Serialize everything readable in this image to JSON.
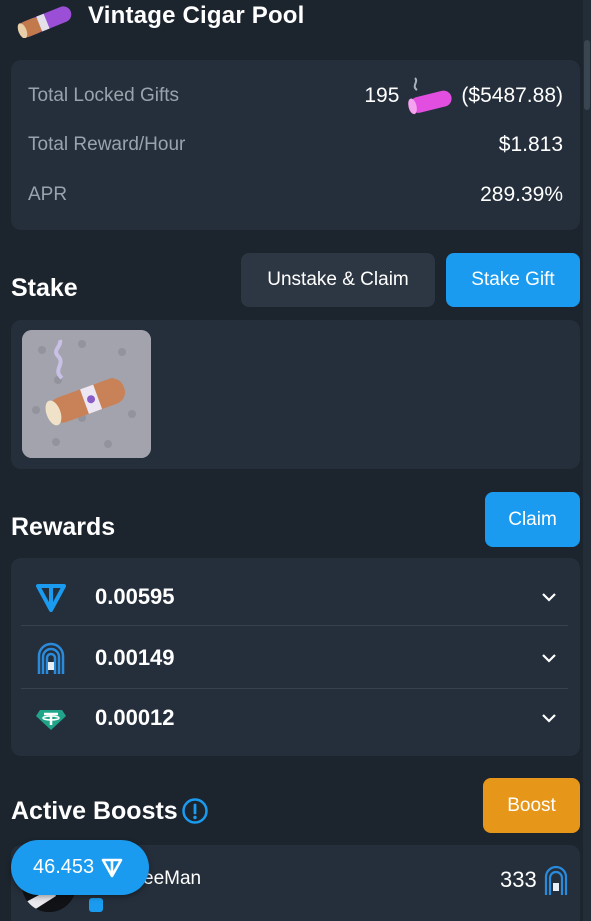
{
  "header": {
    "title": "Vintage Cigar Pool",
    "icon": "cigar-icon"
  },
  "stats": {
    "locked_label": "Total Locked Gifts",
    "locked_count": "195",
    "locked_usd": "($5487.88)",
    "reward_label": "Total Reward/Hour",
    "reward_value": "$1.813",
    "apr_label": "APR",
    "apr_value": "289.39%"
  },
  "stake": {
    "title": "Stake",
    "unstake_label": "Unstake & Claim",
    "stake_gift_label": "Stake Gift"
  },
  "rewards": {
    "title": "Rewards",
    "claim_label": "Claim",
    "items": [
      {
        "icon": "ton-icon",
        "amount": "0.00595"
      },
      {
        "icon": "fingerprint-token-icon",
        "amount": "0.00149"
      },
      {
        "icon": "tether-icon",
        "amount": "0.00012"
      }
    ]
  },
  "boosts": {
    "title": "Active Boosts",
    "boost_label": "Boost",
    "items": [
      {
        "name": "eeMan",
        "count": "333"
      }
    ]
  },
  "balance": {
    "value": "46.453",
    "icon": "ton-icon"
  },
  "colors": {
    "background": "#1c242e",
    "card": "#252f3b",
    "accent_blue": "#1a9bef",
    "boost_orange": "#e69618",
    "muted_text": "#9aa3ad"
  }
}
